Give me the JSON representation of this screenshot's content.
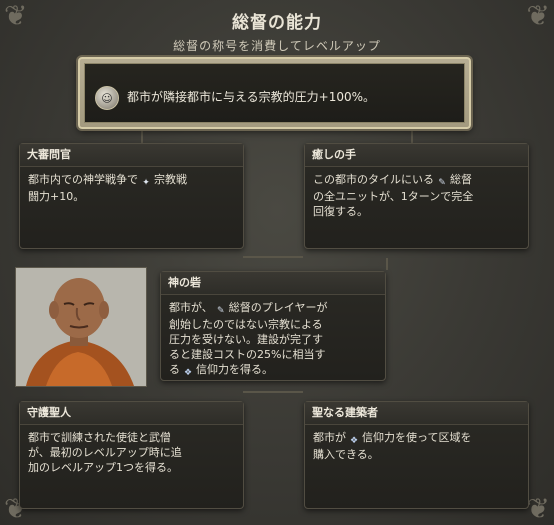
{
  "header": {
    "title": "総督の能力",
    "subtitle": "総督の称号を消費してレベルアップ"
  },
  "banner": {
    "text": "都市が隣接都市に与える宗教的圧力+100%。",
    "icon": "governor-medallion-icon"
  },
  "cards": {
    "grand_inquisitor": {
      "title": "大審問官",
      "line1_pre": "都市内での神学戦争で",
      "line1_post": "宗教戦",
      "line2": "闘力+10。"
    },
    "laying_on_of_hands": {
      "title": "癒しの手",
      "line1_pre": "この都市のタイルにいる",
      "line1_post": "総督",
      "line2": "の全ユニットが、1ターンで完全",
      "line3": "回復する。"
    },
    "divine_architect_center": {
      "title": "神の砦",
      "line1_pre": "都市が、",
      "line1_post": "総督のプレイヤーが",
      "line2": "創始したのではない宗教による",
      "line3": "圧力を受けない。建設が完了す",
      "line4": "ると建設コストの25%に相当す",
      "line5_post": "信仰力を得る。",
      "line5_pre": "る"
    },
    "patron_saint": {
      "title": "守護聖人",
      "line1": "都市で訓練された使徒と武僧",
      "line2": "が、最初のレベルアップ時に追",
      "line3": "加のレベルアップ1つを得る。"
    },
    "holy_architect": {
      "title": "聖なる建築者",
      "line1_pre": "都市が",
      "line1_post": "信仰力を使って区域を",
      "line2": "購入できる。"
    }
  },
  "icons": {
    "combat": "religious-combat-icon",
    "governor": "governor-quill-icon",
    "faith": "faith-icon"
  },
  "colors": {
    "banner_border": "#d6cca8",
    "card_bg": "#2b2a25",
    "text": "#e5e0d2"
  }
}
